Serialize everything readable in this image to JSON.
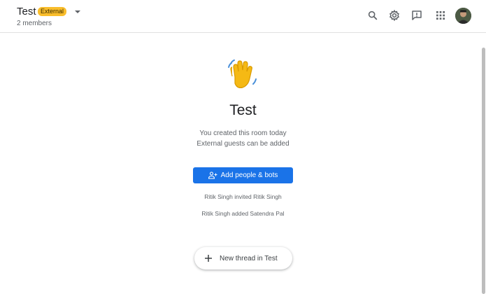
{
  "header": {
    "room_title": "Test",
    "badge": "External",
    "members": "2 members",
    "icons": [
      "search-icon",
      "gear-icon",
      "feedback-icon",
      "apps-grid-icon",
      "avatar"
    ]
  },
  "main": {
    "title": "Test",
    "info_line_1": "You created this room today",
    "info_line_2": "External guests can be added",
    "add_button_label": "Add people & bots",
    "events": [
      "Ritik Singh invited Ritik Singh",
      "Ritik Singh added Satendra Pal"
    ],
    "new_thread_label": "New thread in Test"
  },
  "colors": {
    "accent": "#1a73e8",
    "badge": "#f9bd2b",
    "text_secondary": "#5f6368"
  }
}
